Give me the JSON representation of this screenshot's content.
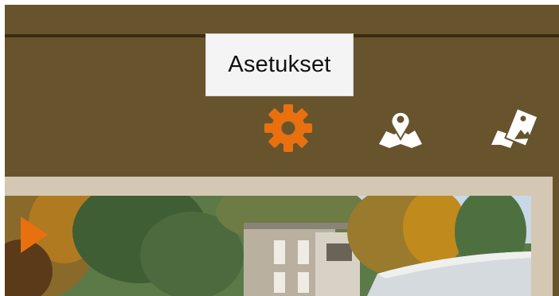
{
  "tooltip": {
    "text": "Asetukset"
  },
  "toolbar": {
    "icons": [
      "gear-icon",
      "map-pin-icon",
      "photo-map-icon"
    ]
  },
  "colors": {
    "header_background": "#68542c",
    "divider": "#3b2c12",
    "accent": "#e8700f",
    "icon_white": "#ffffff",
    "tooltip_background": "#f4f4f4",
    "frame": "#d4c8b4"
  }
}
